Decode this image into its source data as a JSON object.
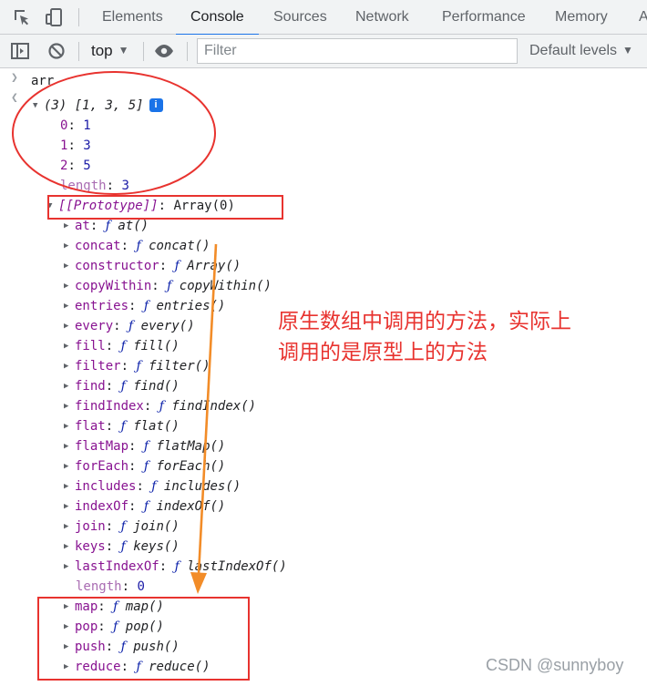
{
  "devtools": {
    "tabs": [
      {
        "label": "Elements"
      },
      {
        "label": "Console"
      },
      {
        "label": "Sources"
      },
      {
        "label": "Network"
      },
      {
        "label": "Performance"
      },
      {
        "label": "Memory"
      },
      {
        "label": "A"
      }
    ],
    "active_tab": "Console",
    "toolbar": {
      "context": "top",
      "filter_placeholder": "Filter",
      "levels": "Default levels"
    }
  },
  "console": {
    "input": "arr",
    "summary": "(3) [1, 3, 5]",
    "info_badge": "i",
    "entries": [
      {
        "key": "0",
        "value": "1"
      },
      {
        "key": "1",
        "value": "3"
      },
      {
        "key": "2",
        "value": "5"
      },
      {
        "key": "length",
        "value": "3"
      }
    ],
    "prototype": {
      "key": "[[Prototype]]",
      "value": "Array(0)"
    },
    "methods": [
      {
        "key": "at",
        "fn": "at()"
      },
      {
        "key": "concat",
        "fn": "concat()"
      },
      {
        "key": "constructor",
        "fn": "Array()"
      },
      {
        "key": "copyWithin",
        "fn": "copyWithin()"
      },
      {
        "key": "entries",
        "fn": "entries()"
      },
      {
        "key": "every",
        "fn": "every()"
      },
      {
        "key": "fill",
        "fn": "fill()"
      },
      {
        "key": "filter",
        "fn": "filter()"
      },
      {
        "key": "find",
        "fn": "find()"
      },
      {
        "key": "findIndex",
        "fn": "findIndex()"
      },
      {
        "key": "flat",
        "fn": "flat()"
      },
      {
        "key": "flatMap",
        "fn": "flatMap()"
      },
      {
        "key": "forEach",
        "fn": "forEach()"
      },
      {
        "key": "includes",
        "fn": "includes()"
      },
      {
        "key": "indexOf",
        "fn": "indexOf()"
      },
      {
        "key": "join",
        "fn": "join()"
      },
      {
        "key": "keys",
        "fn": "keys()"
      },
      {
        "key": "lastIndexOf",
        "fn": "lastIndexOf()"
      }
    ],
    "proto_length": {
      "key": "length",
      "value": "0"
    },
    "methods_after": [
      {
        "key": "map",
        "fn": "map()"
      },
      {
        "key": "pop",
        "fn": "pop()"
      },
      {
        "key": "push",
        "fn": "push()"
      },
      {
        "key": "reduce",
        "fn": "reduce()"
      }
    ],
    "function_symbol": "ƒ"
  },
  "annotation": {
    "lines": [
      "原生数组中调用的方法，实际上",
      "调用的是原型上的方法"
    ],
    "color": "#e8332f",
    "arrow_color": "#f28c28"
  },
  "watermark": "CSDN @sunnyboy"
}
